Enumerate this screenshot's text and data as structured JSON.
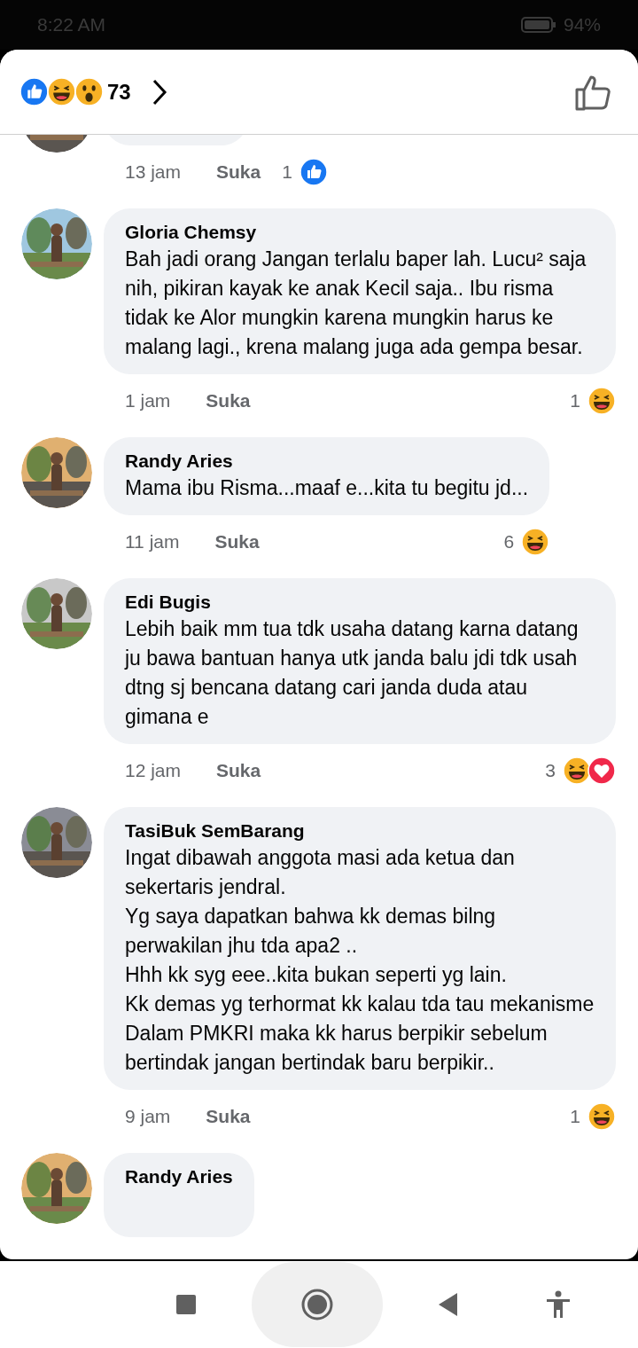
{
  "status_bar": {
    "time": "8:22 AM",
    "battery": "94%"
  },
  "header": {
    "reactions": [
      {
        "kind": "like"
      },
      {
        "kind": "haha"
      },
      {
        "kind": "wow"
      }
    ],
    "count": "73"
  },
  "comments": [
    {
      "kind": "cut_off",
      "time": "13 jam",
      "like_label": "Suka",
      "reaction_count": "1",
      "reactions": [
        {
          "kind": "like"
        }
      ]
    },
    {
      "kind": "full",
      "name": "Gloria Chemsy",
      "text": "Bah jadi orang Jangan terlalu baper lah.  Lucu² saja nih,  pikiran kayak ke anak Kecil saja.. Ibu risma tidak ke Alor mungkin karena mungkin harus ke malang lagi., krena malang juga ada gempa besar.",
      "time": "1 jam",
      "like_label": "Suka",
      "reaction_count": "1",
      "reactions": [
        {
          "kind": "haha"
        }
      ]
    },
    {
      "kind": "full",
      "name": "Randy Aries",
      "text": "Mama ibu Risma...maaf e...kita tu begitu jd...",
      "time": "11 jam",
      "like_label": "Suka",
      "reaction_count": "6",
      "reactions": [
        {
          "kind": "haha"
        }
      ]
    },
    {
      "kind": "full",
      "name": "Edi Bugis",
      "text": "Lebih baik mm tua tdk usaha datang karna datang ju bawa bantuan hanya utk janda balu jdi tdk usah dtng sj bencana datang cari janda duda atau gimana e",
      "time": "12 jam",
      "like_label": "Suka",
      "reaction_count": "3",
      "reactions": [
        {
          "kind": "haha"
        },
        {
          "kind": "love"
        }
      ]
    },
    {
      "kind": "full",
      "name": "TasiBuk SemBarang",
      "text": "Ingat dibawah anggota masi ada ketua dan sekertaris jendral.\nYg saya dapatkan bahwa kk demas bilng perwakilan jhu tda apa2 ..\nHhh kk syg eee..kita bukan seperti yg lain.\nKk demas yg terhormat kk kalau tda tau mekanisme Dalam PMKRI maka kk harus berpikir sebelum bertindak jangan bertindak baru berpikir..",
      "time": "9 jam",
      "like_label": "Suka",
      "reaction_count": "1",
      "reactions": [
        {
          "kind": "haha"
        }
      ]
    },
    {
      "kind": "name_only",
      "name": "Randy Aries"
    }
  ]
}
